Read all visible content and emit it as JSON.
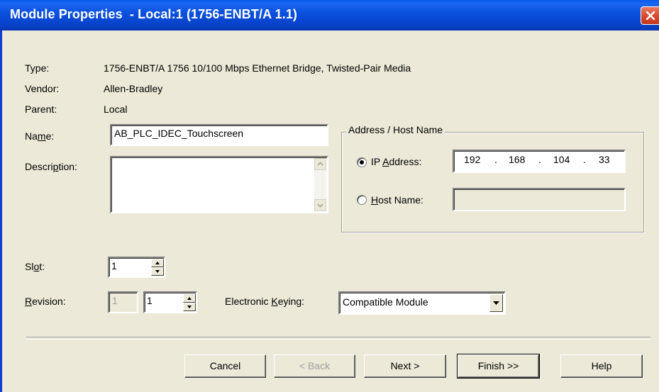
{
  "window": {
    "title": "Module Properties  - Local:1 (1756-ENBT/A 1.1)"
  },
  "info": {
    "type_label": "Type:",
    "type_value": "1756-ENBT/A 1756 10/100 Mbps Ethernet Bridge, Twisted-Pair Media",
    "vendor_label": "Vendor:",
    "vendor_value": "Allen-Bradley",
    "parent_label": "Parent:",
    "parent_value": "Local"
  },
  "name": {
    "label_pre": "Na",
    "label_u": "m",
    "label_post": "e:",
    "value": "AB_PLC_IDEC_Touchscreen"
  },
  "description": {
    "label_pre": "Descri",
    "label_u": "p",
    "label_post": "tion:",
    "value": ""
  },
  "address": {
    "group_title": "Address / Host Name",
    "ip_label_pre": "IP ",
    "ip_label_u": "A",
    "ip_label_post": "ddress:",
    "ip_octets": [
      "192",
      "168",
      "104",
      "33"
    ],
    "ip_dot": ".",
    "host_label_u": "H",
    "host_label_post": "ost Name:",
    "host_value": "",
    "selected": "ip"
  },
  "slot": {
    "label_pre": "Sl",
    "label_u": "o",
    "label_post": "t:",
    "value": "1"
  },
  "revision": {
    "label_u": "R",
    "label_post": "evision:",
    "major": "1",
    "minor": "1"
  },
  "keying": {
    "label_pre": "Electronic ",
    "label_u": "K",
    "label_post": "eying:",
    "value": "Compatible Module"
  },
  "buttons": {
    "cancel": "Cancel",
    "back": "< Back",
    "next": "Next >",
    "finish": "Finish >>",
    "help": "Help"
  },
  "colors": {
    "titlebar": "#0a4fdc",
    "dialog_bg": "#ece9d8",
    "close": "#d6452a"
  }
}
